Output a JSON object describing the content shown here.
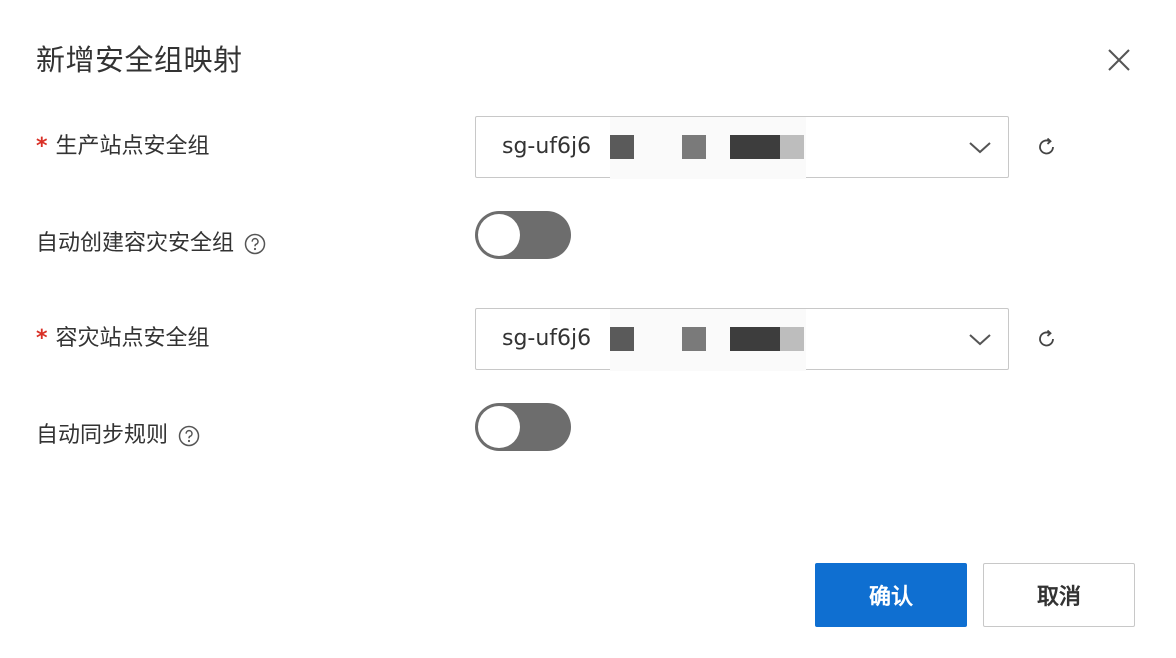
{
  "dialog": {
    "title": "新增安全组映射"
  },
  "form": {
    "production_sg": {
      "required_mark": "*",
      "label": "生产站点安全组",
      "value": "sg-uf6j6"
    },
    "auto_create_dr_sg": {
      "label": "自动创建容灾安全组",
      "enabled": false
    },
    "dr_sg": {
      "required_mark": "*",
      "label": "容灾站点安全组",
      "value": "sg-uf6j6"
    },
    "auto_sync_rules": {
      "label": "自动同步规则",
      "enabled": false
    }
  },
  "footer": {
    "confirm_label": "确认",
    "cancel_label": "取消"
  },
  "colors": {
    "primary": "#0f6fd1",
    "required": "#d93026",
    "toggle_off": "#6d6d6d",
    "border": "#c8c8c8"
  },
  "icons": {
    "close": "close-icon",
    "dropdown": "chevron-down-icon",
    "refresh": "refresh-icon",
    "help": "question-circle-icon"
  }
}
